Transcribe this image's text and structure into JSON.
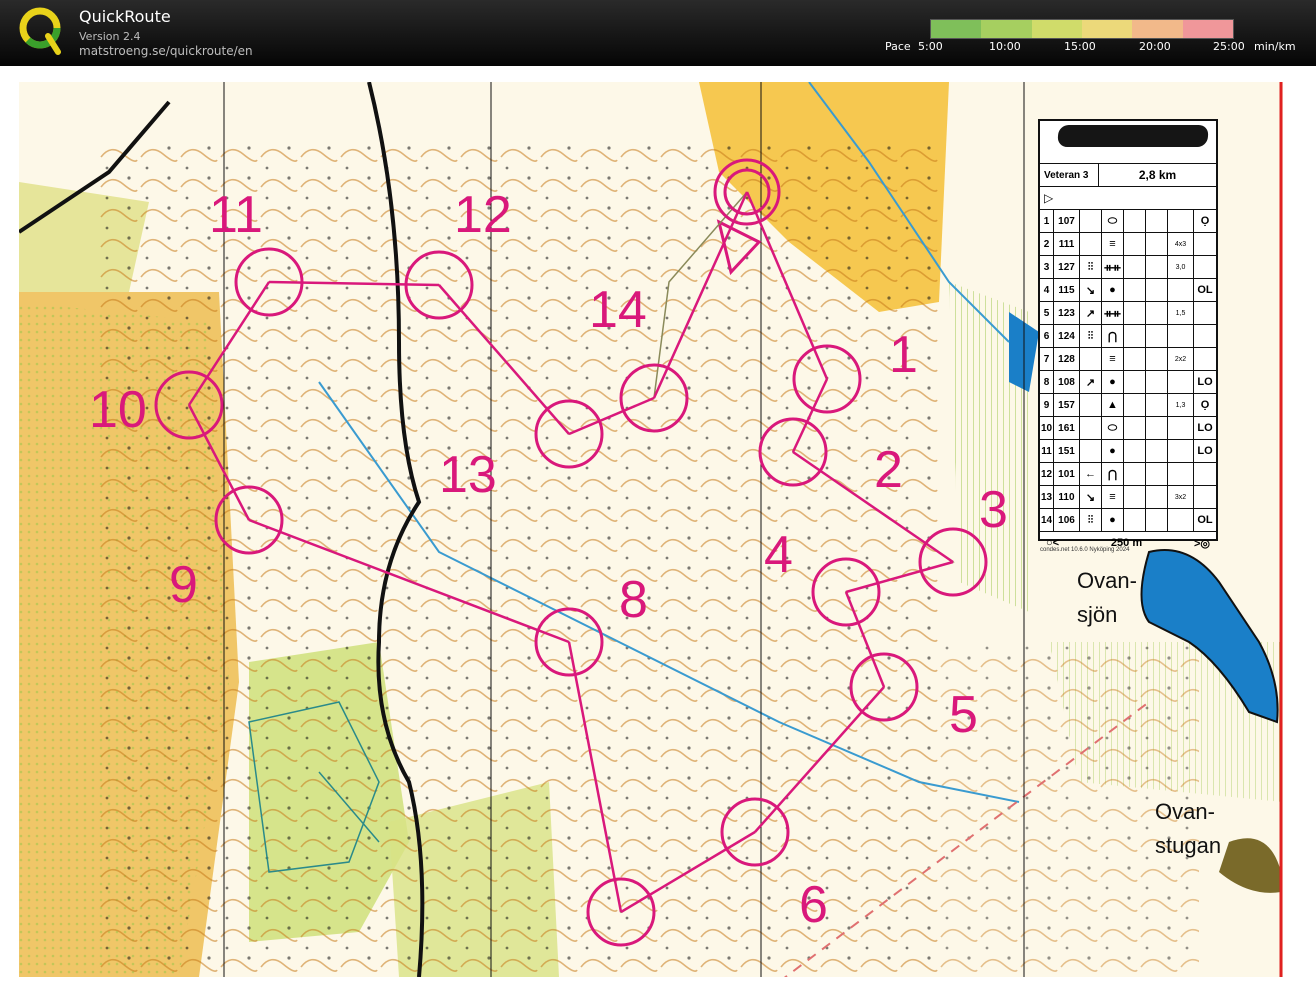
{
  "app": {
    "title": "QuickRoute",
    "version": "Version 2.4",
    "url": "matstroeng.se/quickroute/en"
  },
  "pace": {
    "label": "Pace",
    "ticks": [
      "5:00",
      "10:00",
      "15:00",
      "20:00",
      "25:00"
    ],
    "unit": "min/km",
    "gradient_colors": [
      "#7fbf5a",
      "#a6cf60",
      "#d0dc6a",
      "#ecd97a",
      "#f2b98a",
      "#f0979a"
    ]
  },
  "map": {
    "background_color": "#fdf8e8",
    "course_color": "#d9187b",
    "route_color": "#8a8a5a",
    "controls": [
      {
        "label": "1"
      },
      {
        "label": "2"
      },
      {
        "label": "3"
      },
      {
        "label": "4"
      },
      {
        "label": "5"
      },
      {
        "label": "6"
      },
      {
        "label": "8"
      },
      {
        "label": "9"
      },
      {
        "label": "10"
      },
      {
        "label": "11"
      },
      {
        "label": "12"
      },
      {
        "label": "13"
      },
      {
        "label": "14"
      }
    ],
    "place_names": {
      "lake": [
        "Ovan-",
        "sjön"
      ],
      "cabin": [
        "Ovan-",
        "stugan"
      ]
    }
  },
  "control_descriptions": {
    "class": "Veteran 3",
    "length": "2,8 km",
    "start_symbol": "▷",
    "rows": [
      {
        "n": "1",
        "code": "107",
        "s": "",
        "sym": "⬭",
        "sym2": "",
        "extra": "",
        "dim": "",
        "pos": "Ọ"
      },
      {
        "n": "2",
        "code": "111",
        "s": "",
        "sym": "≡",
        "sym2": "",
        "extra": "",
        "dim": "4x3",
        "pos": ""
      },
      {
        "n": "3",
        "code": "127",
        "s": "⫶⫶",
        "sym": "ᚑᚑ",
        "sym2": "",
        "extra": "",
        "dim": "3,0",
        "pos": ""
      },
      {
        "n": "4",
        "code": "115",
        "s": "↘",
        "sym": "●",
        "sym2": "",
        "extra": "",
        "dim": "",
        "pos": "OL"
      },
      {
        "n": "5",
        "code": "123",
        "s": "↗",
        "sym": "ᚑᚑ",
        "sym2": "",
        "extra": "",
        "dim": "1,5",
        "pos": ""
      },
      {
        "n": "6",
        "code": "124",
        "s": "⫶⫶",
        "sym": "⋂",
        "sym2": "",
        "extra": "",
        "dim": "",
        "pos": ""
      },
      {
        "n": "7",
        "code": "128",
        "s": "",
        "sym": "≡",
        "sym2": "",
        "extra": "",
        "dim": "2x2",
        "pos": ""
      },
      {
        "n": "8",
        "code": "108",
        "s": "↗",
        "sym": "●",
        "sym2": "",
        "extra": "",
        "dim": "",
        "pos": "LO"
      },
      {
        "n": "9",
        "code": "157",
        "s": "",
        "sym": "▲",
        "sym2": "",
        "extra": "",
        "dim": "1,3",
        "pos": "Ọ"
      },
      {
        "n": "10",
        "code": "161",
        "s": "",
        "sym": "⬭",
        "sym2": "",
        "extra": "",
        "dim": "",
        "pos": "LO"
      },
      {
        "n": "11",
        "code": "151",
        "s": "",
        "sym": "●",
        "sym2": "",
        "extra": "",
        "dim": "",
        "pos": "LO"
      },
      {
        "n": "12",
        "code": "101",
        "s": "←",
        "sym": "⋂",
        "sym2": "",
        "extra": "",
        "dim": "",
        "pos": ""
      },
      {
        "n": "13",
        "code": "110",
        "s": "↘",
        "sym": "≡",
        "sym2": "",
        "extra": "",
        "dim": "3x2",
        "pos": ""
      },
      {
        "n": "14",
        "code": "106",
        "s": "⫶⫶",
        "sym": "●",
        "sym2": "",
        "extra": "",
        "dim": "",
        "pos": "OL"
      }
    ],
    "finish": {
      "left": "○<",
      "distance": "250 m",
      "right": ">◎"
    },
    "footer": "condes.net 10.6.0 Nyköping 2024"
  }
}
